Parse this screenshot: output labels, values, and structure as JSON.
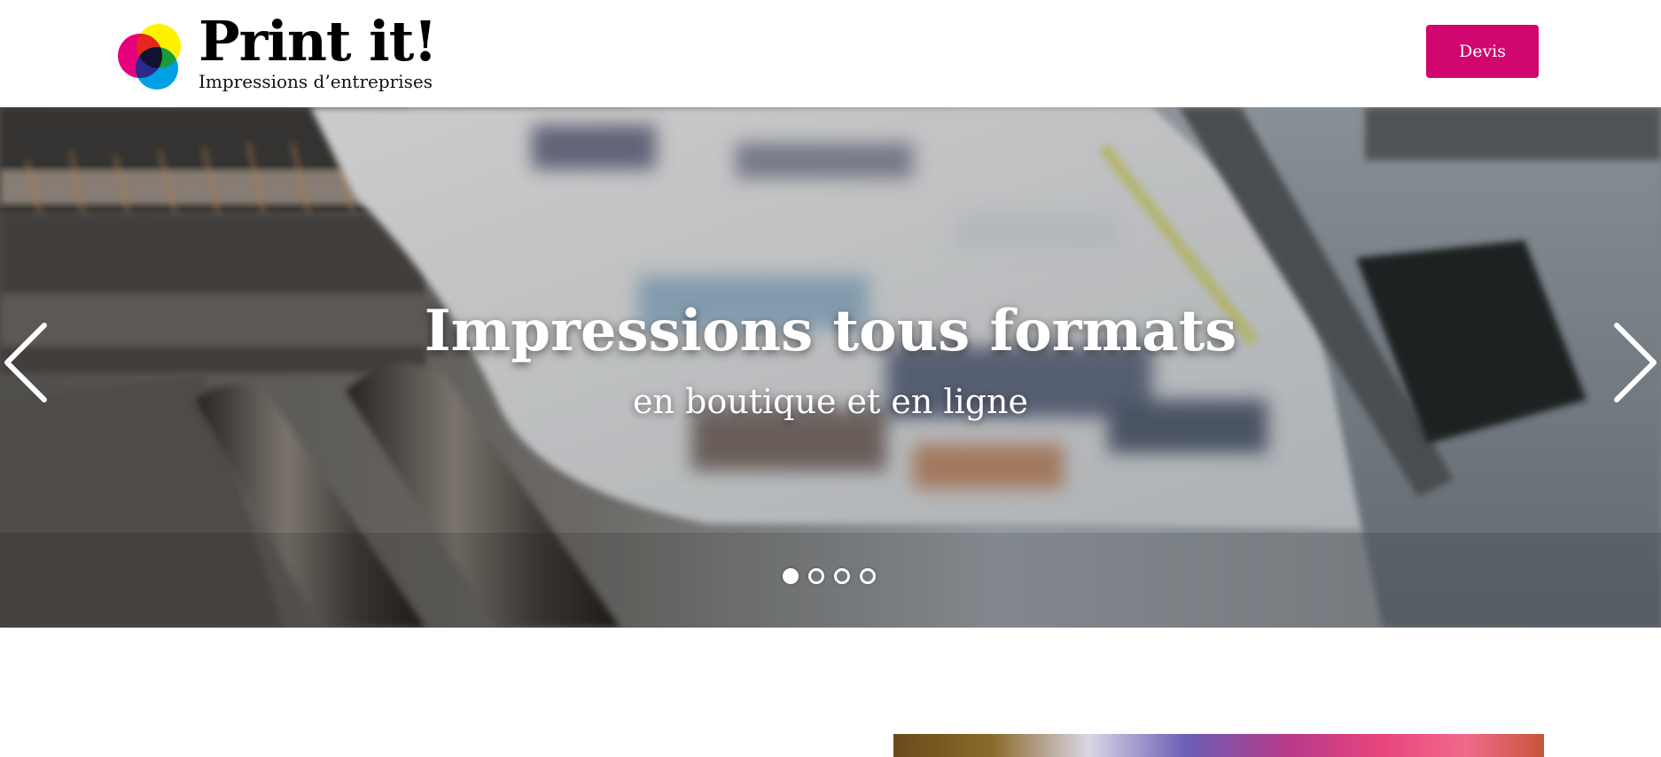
{
  "header": {
    "logo_title": "Print it!",
    "logo_subtitle": "Impressions d’entreprises",
    "cta_label": "Devis"
  },
  "banner": {
    "title": "Impressions tous formats",
    "subtitle": "en boutique et en ligne",
    "slide_count": 4,
    "active_slide": 1,
    "prev_icon": "chevron-left-icon",
    "next_icon": "chevron-right-icon"
  },
  "colors": {
    "accent": "#d1066e",
    "logo_yellow": "#fff200",
    "logo_magenta": "#e6007e",
    "logo_cyan": "#00a0e3",
    "logo_overlap": "#1b1464"
  }
}
